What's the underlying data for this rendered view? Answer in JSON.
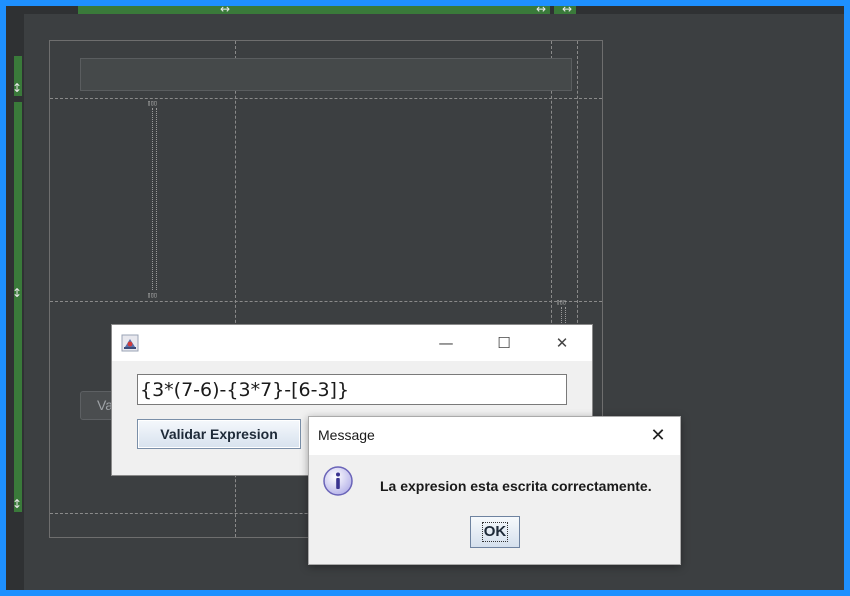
{
  "app_window": {
    "expression_value": "{3*(7-6)-{3*7}-[6-3]}",
    "validate_button_label": "Validar Expresion"
  },
  "designer": {
    "ghost_button_label": "Va"
  },
  "message_dialog": {
    "title": "Message",
    "text": "La expresion esta escrita correctamente.",
    "ok_label": "OK"
  },
  "icons": {
    "window_minimize": "minimize-icon",
    "window_maximize": "maximize-icon",
    "window_close": "close-icon",
    "dialog_close": "close-icon",
    "dialog_info": "info-icon",
    "app_icon": "java-app-icon"
  },
  "colors": {
    "screen_border": "#1e90ff",
    "designer_background": "#3c3f41",
    "anchor_green": "#3a7a3a",
    "dialog_background": "#f0f0f0"
  }
}
